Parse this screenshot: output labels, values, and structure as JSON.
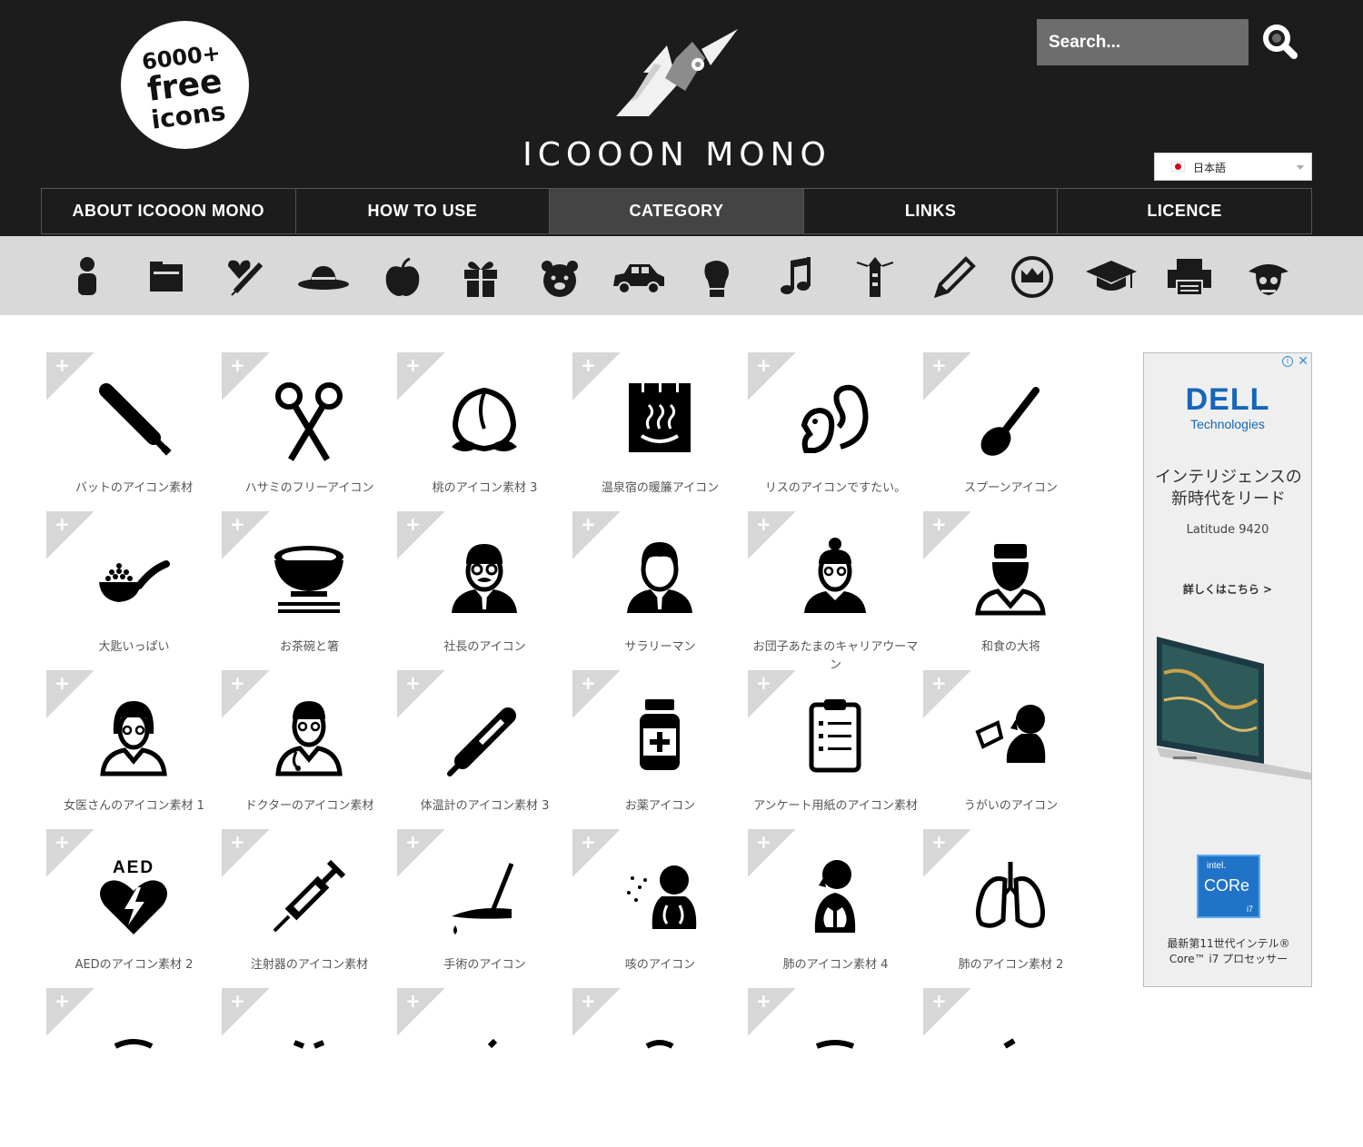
{
  "badge": {
    "line1": "6000+",
    "line2": "free",
    "line3": "icons"
  },
  "site": {
    "title": "ICOOON MONO"
  },
  "search": {
    "placeholder": "Search..."
  },
  "language": {
    "selected": "日本語"
  },
  "nav": {
    "items": [
      {
        "label": "ABOUT ICOOON MONO"
      },
      {
        "label": "HOW TO USE"
      },
      {
        "label": "CATEGORY"
      },
      {
        "label": "LINKS"
      },
      {
        "label": "LICENCE"
      }
    ],
    "active_index": 2
  },
  "categories": [
    "person-icon",
    "folder-icon",
    "medical-heart-syringe-icon",
    "hat-icon",
    "apple-icon",
    "gift-icon",
    "bear-icon",
    "car-icon",
    "boxing-glove-icon",
    "music-note-icon",
    "lighthouse-icon",
    "pencil-icon",
    "crown-badge-icon",
    "graduation-cap-icon",
    "printer-icon",
    "pirate-skull-icon"
  ],
  "icons": [
    {
      "label": "バットのアイコン素材",
      "icon": "baseball-bat-icon"
    },
    {
      "label": "ハサミのフリーアイコン",
      "icon": "scissors-icon"
    },
    {
      "label": "桃のアイコン素材 3",
      "icon": "peach-icon"
    },
    {
      "label": "温泉宿の暖簾アイコン",
      "icon": "hot-spring-noren-icon"
    },
    {
      "label": "リスのアイコンですたい。",
      "icon": "squirrel-icon"
    },
    {
      "label": "スプーンアイコン",
      "icon": "spoon-icon"
    },
    {
      "label": "大匙いっぱい",
      "icon": "tablespoon-icon"
    },
    {
      "label": "お茶碗と箸",
      "icon": "rice-bowl-chopsticks-icon"
    },
    {
      "label": "社長のアイコン",
      "icon": "president-icon"
    },
    {
      "label": "サラリーマン",
      "icon": "salaryman-icon"
    },
    {
      "label": "お団子あたまのキャリアウーマン",
      "icon": "career-woman-icon"
    },
    {
      "label": "和食の大将",
      "icon": "japanese-chef-icon"
    },
    {
      "label": "女医さんのアイコン素材 1",
      "icon": "female-doctor-icon"
    },
    {
      "label": "ドクターのアイコン素材",
      "icon": "doctor-icon"
    },
    {
      "label": "体温計のアイコン素材 3",
      "icon": "thermometer-icon"
    },
    {
      "label": "お薬アイコン",
      "icon": "medicine-bottle-icon"
    },
    {
      "label": "アンケート用紙のアイコン素材",
      "icon": "survey-clipboard-icon"
    },
    {
      "label": "うがいのアイコン",
      "icon": "gargle-icon"
    },
    {
      "label": "AEDのアイコン素材 2",
      "icon": "aed-icon"
    },
    {
      "label": "注射器のアイコン素材",
      "icon": "syringe-icon"
    },
    {
      "label": "手術のアイコン",
      "icon": "surgery-scalpel-icon"
    },
    {
      "label": "咳のアイコン",
      "icon": "cough-icon"
    },
    {
      "label": "肺のアイコン素材 4",
      "icon": "lungs-person-icon"
    },
    {
      "label": "肺のアイコン素材 2",
      "icon": "lungs-icon"
    },
    {
      "label": "",
      "icon": "partial-icon"
    },
    {
      "label": "",
      "icon": "partial-icon"
    },
    {
      "label": "",
      "icon": "partial-icon"
    },
    {
      "label": "",
      "icon": "partial-icon"
    },
    {
      "label": "",
      "icon": "partial-icon"
    },
    {
      "label": "",
      "icon": "partial-icon"
    }
  ],
  "corner_plus": "+",
  "ad": {
    "info": "i",
    "close": "✕",
    "brand": "DELL",
    "brand_sub": "Technologies",
    "headline": "インテリジェンスの新時代をリード",
    "model": "Latitude 9420",
    "cta": "詳しくはこちら >",
    "intel_top": "intel.",
    "intel_mid": "CORe",
    "intel_tier": "i7",
    "footer": "最新第11世代インテル® Core™ i7 プロセッサー"
  }
}
